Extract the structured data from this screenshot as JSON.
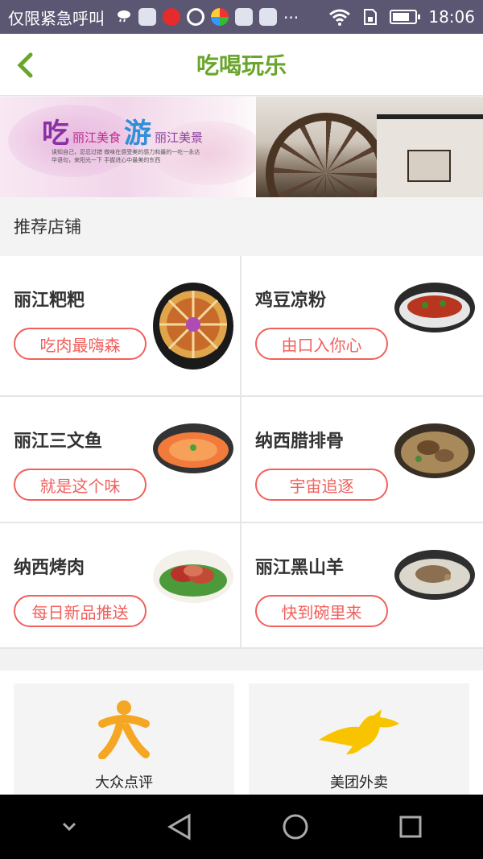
{
  "status_bar": {
    "carrier": "仅限紧急呼叫",
    "time": "18:06",
    "notification_icons": [
      "weather-icon",
      "app-icon",
      "eye-icon",
      "ring-icon",
      "color-app-icon",
      "store-icon",
      "store-icon",
      "more-icon"
    ],
    "more": "···",
    "battery_level": 0.75
  },
  "nav": {
    "title": "吃喝玩乐",
    "back_icon": "back-arrow-icon",
    "accent": "#6aa52c"
  },
  "banner": {
    "big1": "吃",
    "small1": "丽江美食",
    "big2": "游",
    "small2": "丽江美景",
    "caption": "读知自己，忍忍过错 做味在感受美的感力和最的一吃一永达华语句，来阳光一下 手握进心中最美的东西"
  },
  "section": {
    "title": "推荐店铺"
  },
  "shops": [
    {
      "name": "丽江粑粑",
      "tag": "吃肉最嗨森"
    },
    {
      "name": "鸡豆凉粉",
      "tag": "由口入你心"
    },
    {
      "name": "丽江三文鱼",
      "tag": "就是这个味"
    },
    {
      "name": "纳西腊排骨",
      "tag": "宇宙追逐"
    },
    {
      "name": "纳西烤肉",
      "tag": "每日新品推送"
    },
    {
      "name": "丽江黑山羊",
      "tag": "快到碗里来"
    }
  ],
  "partners": [
    {
      "label": "大众点评",
      "icon": "dianping-icon",
      "color": "#f5a623"
    },
    {
      "label": "美团外卖",
      "icon": "kangaroo-icon",
      "color": "#f8c400"
    }
  ],
  "colors": {
    "tag": "#f0605c",
    "status_bar": "#5b5773"
  },
  "system_nav": [
    "chevron-down-icon",
    "back-triangle-icon",
    "home-circle-icon",
    "recents-square-icon"
  ]
}
